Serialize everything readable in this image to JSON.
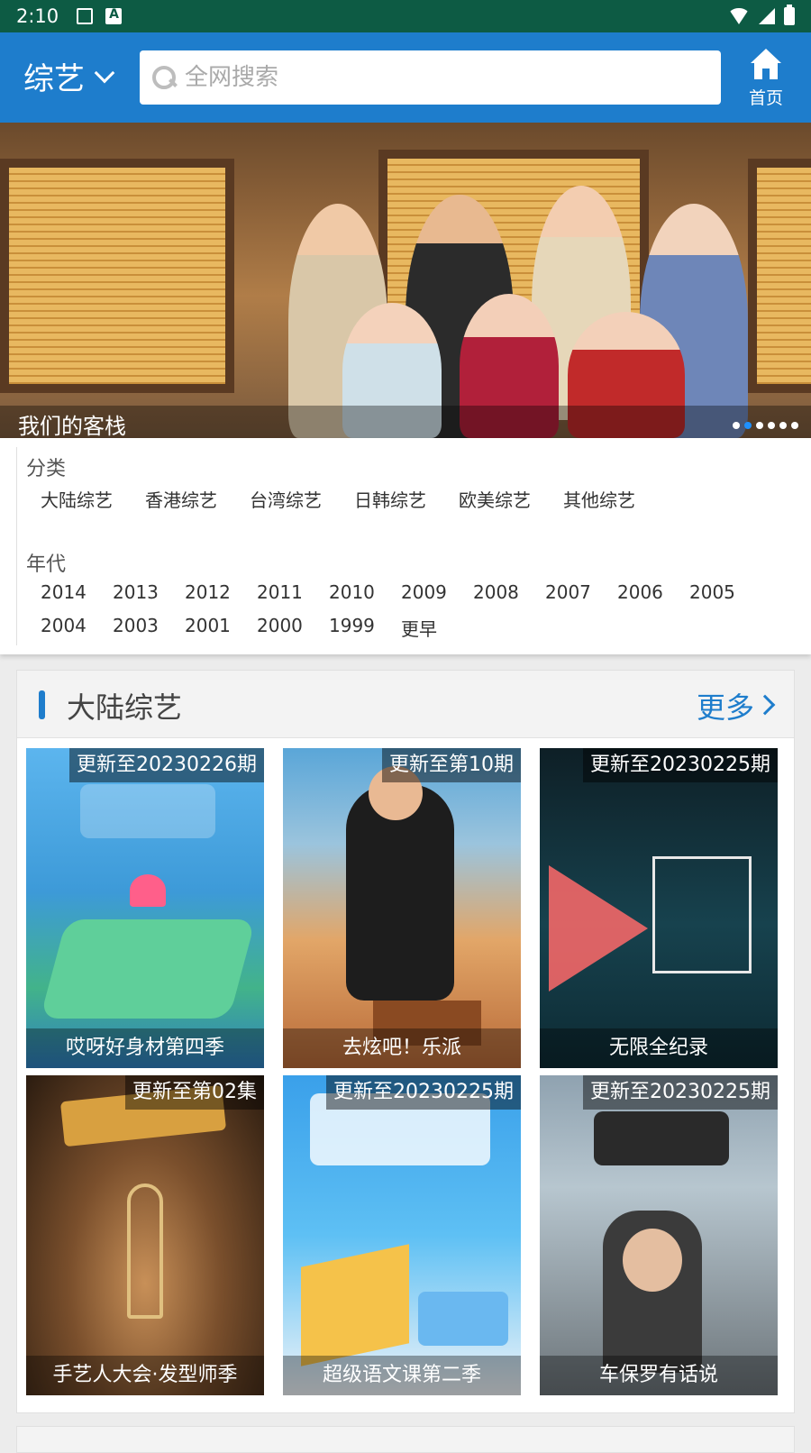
{
  "status_bar": {
    "time": "2:10",
    "icons": [
      "image-icon",
      "a-notification-icon",
      "wifi-icon",
      "signal-icon",
      "battery-icon"
    ]
  },
  "app_bar": {
    "category": "综艺",
    "search_placeholder": "全网搜索",
    "home_label": "首页"
  },
  "banner": {
    "caption": "我们的客栈",
    "slides": 6,
    "active_slide": 2
  },
  "filters": {
    "category_title": "分类",
    "categories": [
      "大陆综艺",
      "香港综艺",
      "台湾综艺",
      "日韩综艺",
      "欧美综艺",
      "其他综艺"
    ],
    "year_title": "年代",
    "years": [
      "2014",
      "2013",
      "2012",
      "2011",
      "2010",
      "2009",
      "2008",
      "2007",
      "2006",
      "2005",
      "2004",
      "2003",
      "2001",
      "2000",
      "1999",
      "更早"
    ]
  },
  "section": {
    "title": "大陆综艺",
    "more_label": "更多",
    "items": [
      {
        "update": "更新至20230226期",
        "name": "哎呀好身材第四季",
        "bg": "#4aa3e0"
      },
      {
        "update": "更新至第10期",
        "name": "去炫吧！乐派",
        "bg": "#d89860"
      },
      {
        "update": "更新至20230225期",
        "name": "无限全纪录",
        "bg": "#13303a"
      },
      {
        "update": "更新至第02集",
        "name": "手艺人大会·发型师季",
        "bg": "#6b4a2a"
      },
      {
        "update": "更新至20230225期",
        "name": "超级语文课第二季",
        "bg": "#3fa8ee"
      },
      {
        "update": "更新至20230225期",
        "name": "车保罗有话说",
        "bg": "#7a8fa0"
      }
    ]
  },
  "colors": {
    "primary": "#1e7dcc",
    "status_bar": "#0d5b44"
  }
}
